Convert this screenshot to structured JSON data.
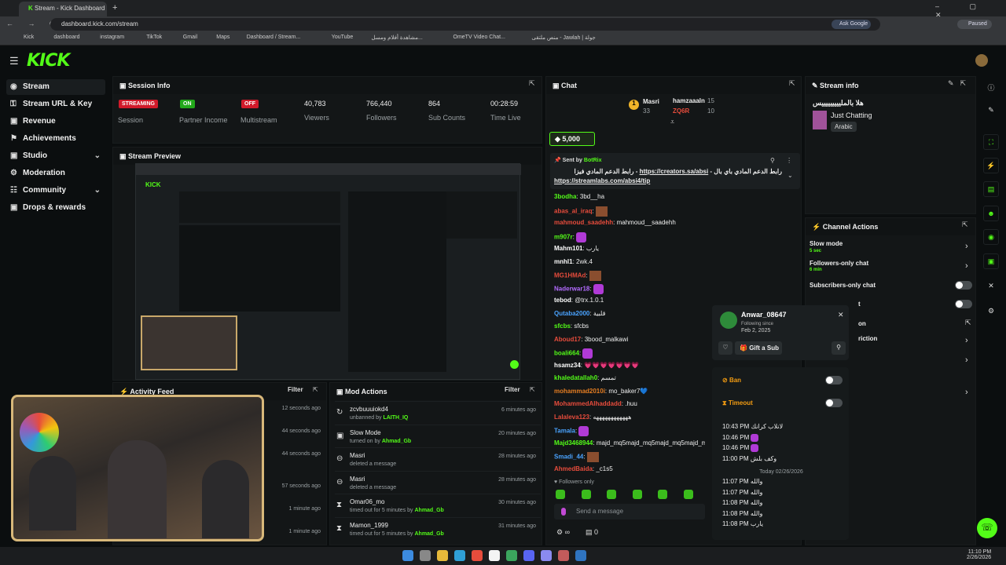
{
  "browser": {
    "tab_title": "Stream - Kick Dashboard",
    "url": "dashboard.kick.com/stream",
    "ask_google": "Ask Google",
    "paused": "Paused",
    "bookmarks": [
      "Kick",
      "dashboard",
      "instagram",
      "TikTok",
      "Gmail",
      "Maps",
      "Dashboard / Stream...",
      "YouTube",
      "مشاهدة أفلام ومسل...",
      "OmeTV Video Chat...",
      "منص ملتقى - Jawlah | جولة"
    ]
  },
  "brand": {
    "logo": "KICK"
  },
  "sidebar": {
    "items": [
      {
        "label": "Stream"
      },
      {
        "label": "Stream URL & Key"
      },
      {
        "label": "Revenue"
      },
      {
        "label": "Achievements"
      },
      {
        "label": "Studio"
      },
      {
        "label": "Moderation"
      },
      {
        "label": "Community"
      },
      {
        "label": "Drops & rewards"
      }
    ]
  },
  "session": {
    "title": "Session Info",
    "cols": [
      {
        "badge": "STREAMING",
        "label": "Session"
      },
      {
        "badge": "ON",
        "label": "Partner Income"
      },
      {
        "badge": "OFF",
        "label": "Multistream"
      },
      {
        "value": "40,783",
        "label": "Viewers"
      },
      {
        "value": "766,440",
        "label": "Followers"
      },
      {
        "value": "864",
        "label": "Sub Counts"
      },
      {
        "value": "00:28:59",
        "label": "Time Live"
      }
    ]
  },
  "preview": {
    "title": "Stream Preview"
  },
  "activity": {
    "title": "Activity Feed",
    "filter": "Filter",
    "times": [
      "12 seconds ago",
      "44 seconds ago",
      "44 seconds ago",
      "57 seconds ago",
      "1 minute ago",
      "1 minute ago"
    ]
  },
  "mod": {
    "title": "Mod Actions",
    "filter": "Filter",
    "rows": [
      {
        "title": "zcvbuuuiokd4",
        "desc": "unbanned by ",
        "by": "LAITH_IQ",
        "time": "6 minutes ago"
      },
      {
        "title": "Slow Mode",
        "desc": "turned on by ",
        "by": "Ahmad_Gb",
        "time": "20 minutes ago"
      },
      {
        "title": "Masri",
        "desc": "deleted a message",
        "by": "",
        "time": "28 minutes ago"
      },
      {
        "title": "Masri",
        "desc": "deleted a message",
        "by": "",
        "time": "28 minutes ago"
      },
      {
        "title": "Omar06_mo",
        "desc": "timed out for 5 minutes by ",
        "by": "Ahmad_Gb",
        "time": "30 minutes ago"
      },
      {
        "title": "Mamon_1999",
        "desc": "timed out for 5 minutes by ",
        "by": "Ahmad_Gb",
        "time": "31 minutes ago"
      }
    ]
  },
  "chat": {
    "title": "Chat",
    "leader1": "Masri",
    "leader1_count": "33",
    "leader2": "hamzaaaln",
    "leader2_count": "15",
    "leader3": "ZQ6R",
    "leader3_count": "10",
    "kicks": "5,000",
    "pinned": {
      "sent_by": "Sent by",
      "bot": "BotRix",
      "text1": "رابط الدعم المادي باي بال - ",
      "link1": "https://creators.sa/absi",
      "text2": " - رابط الدعم المادي فيزا",
      "link2": "https://streamlabs.com/absi4/tip"
    },
    "messages": [
      {
        "user": "3bodha",
        "text": "3bd__ha",
        "color": "#53fc18"
      },
      {
        "user": "abas_al_iraq",
        "text": "",
        "color": "#e74c3c",
        "emote": "img"
      },
      {
        "user": "mahmoud_saadehh",
        "text": "mahmoud__saadehh",
        "color": "#e74c3c"
      },
      {
        "user": "m907r",
        "text": "",
        "color": "#53fc18",
        "emote": "purple"
      },
      {
        "user": "Mahm101",
        "text": "يارب",
        "color": "#ffffff"
      },
      {
        "user": "mnhl1",
        "text": "2wk.4",
        "color": "#ffffff"
      },
      {
        "user": "MG1HMAd",
        "text": "",
        "color": "#e74c3c",
        "emote": "img"
      },
      {
        "user": "Naderwar18",
        "text": "",
        "color": "#b36bff",
        "emote": "purple"
      },
      {
        "user": "tebod",
        "text": "@trx.1.0.1",
        "color": "#ffffff"
      },
      {
        "user": "Qutaba2000",
        "text": "قلبية",
        "color": "#4aa3ff"
      },
      {
        "user": "sfcbs",
        "text": "sfcbs",
        "color": "#53fc18"
      },
      {
        "user": "Aboud17",
        "text": "3bood_malkawi",
        "color": "#e74c3c"
      },
      {
        "user": "boali664",
        "text": "",
        "color": "#53fc18",
        "emote": "purple"
      },
      {
        "user": "hsamz34",
        "text": "💗💗💗💗💗💗💗",
        "color": "#ffffff"
      },
      {
        "user": "khaledatallah0",
        "text": "تمسم",
        "color": "#53fc18"
      },
      {
        "user": "mohammad2010i",
        "text": "mo_baker7💙",
        "color": "#e67e22"
      },
      {
        "user": "MohammedAlhaddadd",
        "text": ".huu",
        "color": "#e74c3c"
      },
      {
        "user": "Lalaleva123",
        "text": "ههههههههههههه",
        "color": "#e74c3c"
      },
      {
        "user": "Tamala",
        "text": "",
        "color": "#4aa3ff",
        "emote": "purple"
      },
      {
        "user": "Majd3468944",
        "text": "majd_mq5majd_mq5majd_mq5majd_mq5",
        "color": "#53fc18"
      },
      {
        "user": "Smadi_44",
        "text": "",
        "color": "#4aa3ff",
        "emote": "img"
      },
      {
        "user": "AhmedBaida",
        "text": "_c1s5",
        "color": "#e74c3c"
      }
    ],
    "followers_only": "Followers only",
    "placeholder": "Send a message",
    "viewers_zero": "0"
  },
  "stream_info": {
    "title": "Stream info",
    "stream_title": "هلا بالمليييييييييس",
    "category": "Just Chatting",
    "language": "Arabic"
  },
  "channel_actions": {
    "title": "Channel Actions",
    "slow_mode": "Slow mode",
    "slow_val": "5 sec",
    "followers_only": "Followers-only chat",
    "followers_val": "6 min",
    "subs_only": "Subscribers-only chat",
    "t": "t",
    "on": "on",
    "restriction": "riction"
  },
  "usercard": {
    "name": "Anwar_08647",
    "following_since": "Following since",
    "date": "Feb 2, 2025",
    "gift": "Gift a Sub",
    "ban": "Ban",
    "timeout": "Timeout",
    "log": [
      {
        "time": "10:43 PM",
        "text": "لانلاب كرانك"
      },
      {
        "time": "10:46 PM",
        "text": ""
      },
      {
        "time": "10:46 PM",
        "text": ""
      },
      {
        "time": "11:00 PM",
        "text": "وكف بلش"
      }
    ],
    "divider": "Today 02/26/2026",
    "log2": [
      {
        "time": "11:07 PM",
        "text": "والله"
      },
      {
        "time": "11:07 PM",
        "text": "والله"
      },
      {
        "time": "11:08 PM",
        "text": "والله"
      },
      {
        "time": "11:08 PM",
        "text": "والله"
      },
      {
        "time": "11:08 PM",
        "text": "يارب"
      }
    ]
  },
  "clock": {
    "time": "11:10 PM",
    "date": "2/26/2026"
  }
}
